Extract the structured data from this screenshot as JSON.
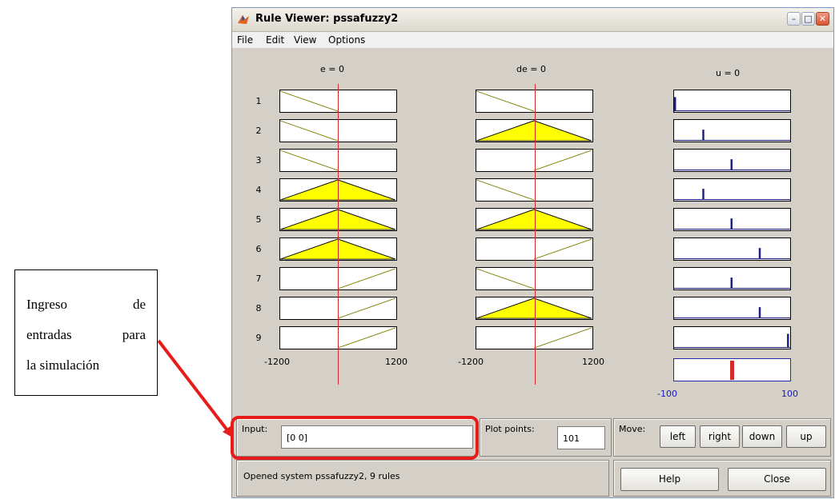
{
  "window": {
    "title": "Rule Viewer: pssafuzzy2"
  },
  "menu": [
    "File",
    "Edit",
    "View",
    "Options"
  ],
  "inputs": [
    {
      "header": "e = 0",
      "range_min": "-1200",
      "range_max": "1200"
    },
    {
      "header": "de = 0",
      "range_min": "-1200",
      "range_max": "1200"
    }
  ],
  "output": {
    "header": "u = 0",
    "range_min": "-100",
    "range_max": "100"
  },
  "rules": [
    {
      "num": "1",
      "e": "dec",
      "de": "dec",
      "u": 0.0
    },
    {
      "num": "2",
      "e": "dec",
      "de": "tri",
      "u": 0.25
    },
    {
      "num": "3",
      "e": "dec",
      "de": "inc",
      "u": 0.5
    },
    {
      "num": "4",
      "e": "tri",
      "de": "dec",
      "u": 0.25
    },
    {
      "num": "5",
      "e": "tri",
      "de": "tri",
      "u": 0.5
    },
    {
      "num": "6",
      "e": "tri",
      "de": "inc",
      "u": 0.75
    },
    {
      "num": "7",
      "e": "inc",
      "de": "dec",
      "u": 0.5
    },
    {
      "num": "8",
      "e": "inc",
      "de": "tri",
      "u": 0.75
    },
    {
      "num": "9",
      "e": "inc",
      "de": "inc",
      "u": 1.0
    }
  ],
  "aggregate": {
    "value_fraction": 0.5
  },
  "input_panel": {
    "label": "Input:",
    "value": "[0 0]"
  },
  "plot_panel": {
    "label": "Plot points:",
    "value": "101"
  },
  "move_panel": {
    "label": "Move:",
    "left": "left",
    "right": "right",
    "down": "down",
    "up": "up"
  },
  "status": "Opened system pssafuzzy2, 9 rules",
  "buttons": {
    "help": "Help",
    "close": "Close"
  },
  "annotation": {
    "line1a": "Ingreso",
    "line1b": "de",
    "line2a": "entradas",
    "line2b": "para",
    "line3": "la simulación"
  },
  "colors": {
    "fill": "#ffff00",
    "cursor": "#d62a2a",
    "callout": "#e81b1b",
    "output_axis": "#1818b8"
  }
}
